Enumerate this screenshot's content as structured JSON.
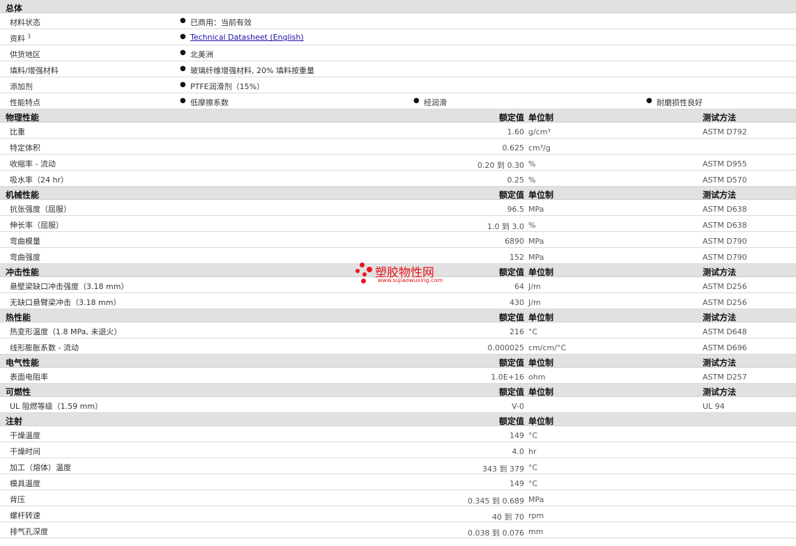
{
  "general": {
    "title": "总体",
    "material_status_label": "材料状态",
    "material_status_value": "已商用：当前有效",
    "docs_label": "资料",
    "docs_sup": "1",
    "docs_link": "Technical Datasheet (English)",
    "region_label": "供货地区",
    "region_value": "北美洲",
    "filler_label": "填料/增强材料",
    "filler_value": "玻璃纤维增强材料, 20% 填料按重量",
    "additive_label": "添加剂",
    "additive_value": "PTFE润滑剂（15%）",
    "features_label": "性能特点",
    "features": [
      "低摩擦系数",
      "经润滑",
      "耐磨损性良好"
    ],
    "bullet": "●"
  },
  "headers": {
    "value": "额定值",
    "unit": "单位制",
    "method": "测试方法"
  },
  "sections": {
    "physical": {
      "title": "物理性能",
      "rows": [
        {
          "label": "比重",
          "value": "1.60",
          "unit": "g/cm³",
          "method": "ASTM D792"
        },
        {
          "label": "特定体积",
          "value": "0.625",
          "unit": "cm³/g",
          "method": ""
        },
        {
          "label": "收缩率 - 流动",
          "value": "0.20 到  0.30",
          "unit": "%",
          "method": "ASTM D955"
        },
        {
          "label": "吸水率（24 hr）",
          "value": "0.25",
          "unit": "%",
          "method": "ASTM D570"
        }
      ]
    },
    "mechanical": {
      "title": "机械性能",
      "rows": [
        {
          "label": "抗张强度（屈服）",
          "value": "96.5",
          "unit": "MPa",
          "method": "ASTM D638"
        },
        {
          "label": "伸长率（屈服）",
          "value": "1.0 到  3.0",
          "unit": "%",
          "method": "ASTM D638"
        },
        {
          "label": "弯曲模量",
          "value": "6890",
          "unit": "MPa",
          "method": "ASTM D790"
        },
        {
          "label": "弯曲强度",
          "value": "152",
          "unit": "MPa",
          "method": "ASTM D790"
        }
      ]
    },
    "impact": {
      "title": "冲击性能",
      "rows": [
        {
          "label": "悬壁梁缺口冲击强度（3.18 mm）",
          "value": "64",
          "unit": "J/m",
          "method": "ASTM D256"
        },
        {
          "label": "无缺口悬臂梁冲击（3.18 mm）",
          "value": "430",
          "unit": "J/m",
          "method": "ASTM D256"
        }
      ]
    },
    "thermal": {
      "title": "热性能",
      "rows": [
        {
          "label": "热变形温度（1.8 MPa, 未退火）",
          "value": "216",
          "unit": "°C",
          "method": "ASTM D648"
        },
        {
          "label": "线形膨胀系数 - 流动",
          "value": "0.000025",
          "unit": "cm/cm/°C",
          "method": "ASTM D696"
        }
      ]
    },
    "electrical": {
      "title": "电气性能",
      "rows": [
        {
          "label": "表面电阻率",
          "value": "1.0E+16",
          "unit": "ohm",
          "method": "ASTM D257"
        }
      ]
    },
    "flammability": {
      "title": "可燃性",
      "rows": [
        {
          "label": "UL 阻燃等级（1.59 mm）",
          "value": "V-0",
          "unit": "",
          "method": "UL 94"
        }
      ]
    },
    "injection": {
      "title": "注射",
      "rows": [
        {
          "label": "干燥温度",
          "value": "149",
          "unit": "°C",
          "method": ""
        },
        {
          "label": "干燥时间",
          "value": "4.0",
          "unit": "hr",
          "method": ""
        },
        {
          "label": "加工（熔体）温度",
          "value": "343 到  379",
          "unit": "°C",
          "method": ""
        },
        {
          "label": "模具温度",
          "value": "149",
          "unit": "°C",
          "method": ""
        },
        {
          "label": "背压",
          "value": "0.345 到  0.689",
          "unit": "MPa",
          "method": ""
        },
        {
          "label": "螺杆转速",
          "value": "40 到  70",
          "unit": "rpm",
          "method": ""
        },
        {
          "label": "排气孔深度",
          "value": "0.038 到  0.076",
          "unit": "mm",
          "method": ""
        }
      ]
    }
  },
  "watermark": {
    "text": "塑胶物性网",
    "url": "www.sujiaowuxing.com",
    "color": "#e8141c"
  }
}
